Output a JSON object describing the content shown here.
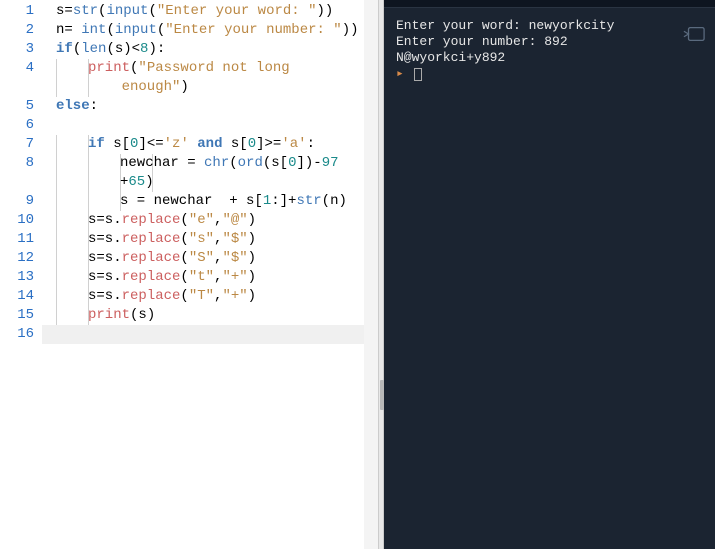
{
  "editor": {
    "line_numbers": [
      "1",
      "2",
      "3",
      "4",
      "5",
      "6",
      "7",
      "8",
      "9",
      "10",
      "11",
      "12",
      "13",
      "14",
      "15",
      "16"
    ],
    "code_lines": [
      {
        "indent": 0,
        "segments": [
          {
            "t": "s=",
            "c": "tok-plain"
          },
          {
            "t": "str",
            "c": "tok-builtin"
          },
          {
            "t": "(",
            "c": "tok-plain"
          },
          {
            "t": "input",
            "c": "tok-builtin"
          },
          {
            "t": "(",
            "c": "tok-plain"
          },
          {
            "t": "\"Enter your word: \"",
            "c": "tok-str"
          },
          {
            "t": "))",
            "c": "tok-plain"
          }
        ]
      },
      {
        "indent": 0,
        "segments": [
          {
            "t": "n= ",
            "c": "tok-plain"
          },
          {
            "t": "int",
            "c": "tok-builtin"
          },
          {
            "t": "(",
            "c": "tok-plain"
          },
          {
            "t": "input",
            "c": "tok-builtin"
          },
          {
            "t": "(",
            "c": "tok-plain"
          },
          {
            "t": "\"Enter your number: \"",
            "c": "tok-str"
          },
          {
            "t": "))",
            "c": "tok-plain"
          }
        ]
      },
      {
        "indent": 0,
        "segments": [
          {
            "t": "if",
            "c": "tok-kw"
          },
          {
            "t": "(",
            "c": "tok-plain"
          },
          {
            "t": "len",
            "c": "tok-builtin"
          },
          {
            "t": "(s)<",
            "c": "tok-plain"
          },
          {
            "t": "8",
            "c": "tok-num"
          },
          {
            "t": "):",
            "c": "tok-plain"
          }
        ]
      },
      {
        "indent": 1,
        "wrap": true,
        "segments": [
          {
            "t": "print",
            "c": "tok-func"
          },
          {
            "t": "(",
            "c": "tok-plain"
          },
          {
            "t": "\"Password not long \n    enough\"",
            "c": "tok-str"
          },
          {
            "t": ")",
            "c": "tok-plain"
          }
        ]
      },
      {
        "indent": 0,
        "segments": [
          {
            "t": "else",
            "c": "tok-kw"
          },
          {
            "t": ":",
            "c": "tok-plain"
          }
        ]
      },
      {
        "indent": 0,
        "segments": []
      },
      {
        "indent": 1,
        "segments": [
          {
            "t": "if",
            "c": "tok-kw"
          },
          {
            "t": " s[",
            "c": "tok-plain"
          },
          {
            "t": "0",
            "c": "tok-num"
          },
          {
            "t": "]<=",
            "c": "tok-plain"
          },
          {
            "t": "'z'",
            "c": "tok-str"
          },
          {
            "t": " ",
            "c": "tok-plain"
          },
          {
            "t": "and",
            "c": "tok-kw"
          },
          {
            "t": " s[",
            "c": "tok-plain"
          },
          {
            "t": "0",
            "c": "tok-num"
          },
          {
            "t": "]>=",
            "c": "tok-plain"
          },
          {
            "t": "'a'",
            "c": "tok-str"
          },
          {
            "t": ":",
            "c": "tok-plain"
          }
        ]
      },
      {
        "indent": 2,
        "wrap": true,
        "segments": [
          {
            "t": "newchar = ",
            "c": "tok-plain"
          },
          {
            "t": "chr",
            "c": "tok-builtin"
          },
          {
            "t": "(",
            "c": "tok-plain"
          },
          {
            "t": "ord",
            "c": "tok-builtin"
          },
          {
            "t": "(s[",
            "c": "tok-plain"
          },
          {
            "t": "0",
            "c": "tok-num"
          },
          {
            "t": "])-",
            "c": "tok-plain"
          },
          {
            "t": "97",
            "c": "tok-num"
          },
          {
            "t": "\n+",
            "c": "tok-plain"
          },
          {
            "t": "65",
            "c": "tok-num"
          },
          {
            "t": ")",
            "c": "tok-plain"
          }
        ]
      },
      {
        "indent": 2,
        "segments": [
          {
            "t": "s = newchar  + s[",
            "c": "tok-plain"
          },
          {
            "t": "1",
            "c": "tok-num"
          },
          {
            "t": ":]+",
            "c": "tok-plain"
          },
          {
            "t": "str",
            "c": "tok-builtin"
          },
          {
            "t": "(n)",
            "c": "tok-plain"
          }
        ]
      },
      {
        "indent": 1,
        "segments": [
          {
            "t": "s=s.",
            "c": "tok-plain"
          },
          {
            "t": "replace",
            "c": "tok-func"
          },
          {
            "t": "(",
            "c": "tok-plain"
          },
          {
            "t": "\"e\"",
            "c": "tok-str"
          },
          {
            "t": ",",
            "c": "tok-plain"
          },
          {
            "t": "\"@\"",
            "c": "tok-str"
          },
          {
            "t": ")",
            "c": "tok-plain"
          }
        ]
      },
      {
        "indent": 1,
        "segments": [
          {
            "t": "s=s.",
            "c": "tok-plain"
          },
          {
            "t": "replace",
            "c": "tok-func"
          },
          {
            "t": "(",
            "c": "tok-plain"
          },
          {
            "t": "\"s\"",
            "c": "tok-str"
          },
          {
            "t": ",",
            "c": "tok-plain"
          },
          {
            "t": "\"$\"",
            "c": "tok-str"
          },
          {
            "t": ")",
            "c": "tok-plain"
          }
        ]
      },
      {
        "indent": 1,
        "segments": [
          {
            "t": "s=s.",
            "c": "tok-plain"
          },
          {
            "t": "replace",
            "c": "tok-func"
          },
          {
            "t": "(",
            "c": "tok-plain"
          },
          {
            "t": "\"S\"",
            "c": "tok-str"
          },
          {
            "t": ",",
            "c": "tok-plain"
          },
          {
            "t": "\"$\"",
            "c": "tok-str"
          },
          {
            "t": ")",
            "c": "tok-plain"
          }
        ]
      },
      {
        "indent": 1,
        "segments": [
          {
            "t": "s=s.",
            "c": "tok-plain"
          },
          {
            "t": "replace",
            "c": "tok-func"
          },
          {
            "t": "(",
            "c": "tok-plain"
          },
          {
            "t": "\"t\"",
            "c": "tok-str"
          },
          {
            "t": ",",
            "c": "tok-plain"
          },
          {
            "t": "\"+\"",
            "c": "tok-str"
          },
          {
            "t": ")",
            "c": "tok-plain"
          }
        ]
      },
      {
        "indent": 1,
        "segments": [
          {
            "t": "s=s.",
            "c": "tok-plain"
          },
          {
            "t": "replace",
            "c": "tok-func"
          },
          {
            "t": "(",
            "c": "tok-plain"
          },
          {
            "t": "\"T\"",
            "c": "tok-str"
          },
          {
            "t": ",",
            "c": "tok-plain"
          },
          {
            "t": "\"+\"",
            "c": "tok-str"
          },
          {
            "t": ")",
            "c": "tok-plain"
          }
        ]
      },
      {
        "indent": 1,
        "segments": [
          {
            "t": "print",
            "c": "tok-func"
          },
          {
            "t": "(s)",
            "c": "tok-plain"
          }
        ]
      },
      {
        "indent": 0,
        "segments": []
      }
    ]
  },
  "terminal": {
    "lines": [
      "Enter your word: newyorkcity",
      "Enter your number: 892",
      "N@wyorkci+y892"
    ],
    "prompt": "▸"
  }
}
